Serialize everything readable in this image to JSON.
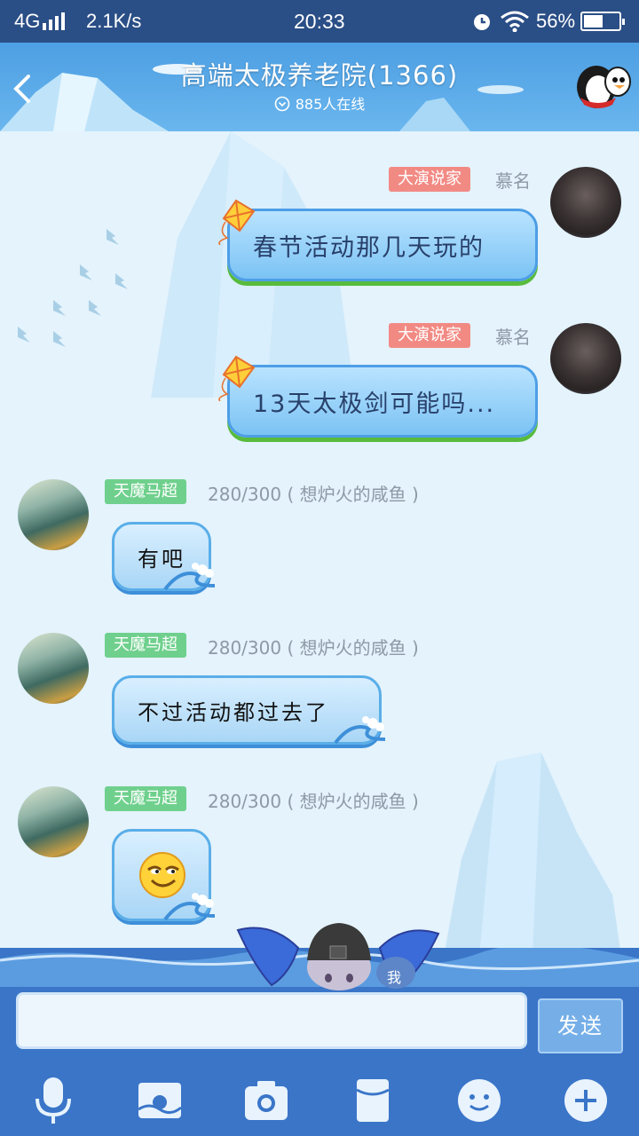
{
  "status_bar": {
    "network": "4G",
    "speed": "2.1K/s",
    "time": "20:33",
    "battery": "56%",
    "battery_level": 0.56
  },
  "header": {
    "title": "高端太极养老院(1366)",
    "online": "885人在线"
  },
  "messages": [
    {
      "side": "right",
      "tag": "大演说家",
      "name": "慕名",
      "text": "春节活动那几天玩的"
    },
    {
      "side": "right",
      "tag": "大演说家",
      "name": "慕名",
      "text": "13天太极剑可能吗..."
    },
    {
      "side": "left",
      "tag": "天魔马超",
      "name": "280/300 ( 想炉火的咸鱼 )",
      "text": "有吧"
    },
    {
      "side": "left",
      "tag": "天魔马超",
      "name": "280/300 ( 想炉火的咸鱼 )",
      "text": "不过活动都过去了"
    },
    {
      "side": "left",
      "tag": "天魔马超",
      "name": "280/300 ( 想炉火的咸鱼 )",
      "text": "",
      "emoji": "smirk-face-emoji"
    }
  ],
  "composer": {
    "send_label": "发送",
    "mascot_label": "我"
  },
  "toolbar": [
    "microphone-icon",
    "image-icon",
    "camera-icon",
    "red-packet-icon",
    "emoji-icon",
    "plus-icon"
  ],
  "colors": {
    "status_bar": "#2a4e86",
    "header": "#4d9fe3",
    "tag_red": "#f28a84",
    "tag_green": "#6fd08d",
    "panel": "#3a75c8"
  }
}
